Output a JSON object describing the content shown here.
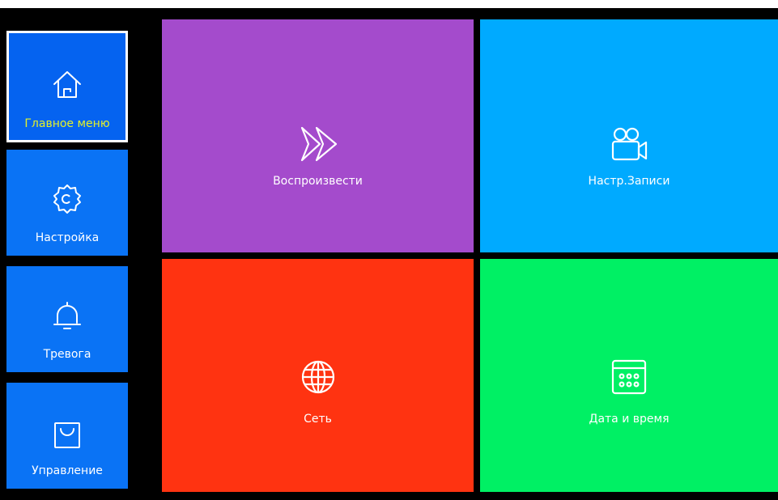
{
  "sidebar": {
    "items": [
      {
        "label": "Главное меню",
        "icon": "home-icon",
        "active": true
      },
      {
        "label": "Настройка",
        "icon": "gear-icon",
        "active": false
      },
      {
        "label": "Тревога",
        "icon": "bell-icon",
        "active": false
      },
      {
        "label": "Управление",
        "icon": "bag-icon",
        "active": false
      }
    ]
  },
  "tiles": [
    {
      "label": "Воспроизвести",
      "icon": "fast-forward-icon",
      "color": "#a44bcc"
    },
    {
      "label": "Настр.Записи",
      "icon": "video-camera-icon",
      "color": "#00aaff"
    },
    {
      "label": "Сеть",
      "icon": "globe-icon",
      "color": "#ff3311"
    },
    {
      "label": "Дата и время",
      "icon": "calendar-icon",
      "color": "#00f064"
    }
  ],
  "colors": {
    "background": "#000000",
    "sidebar_item": "#0a73f5",
    "active_label": "#e3f12a"
  }
}
